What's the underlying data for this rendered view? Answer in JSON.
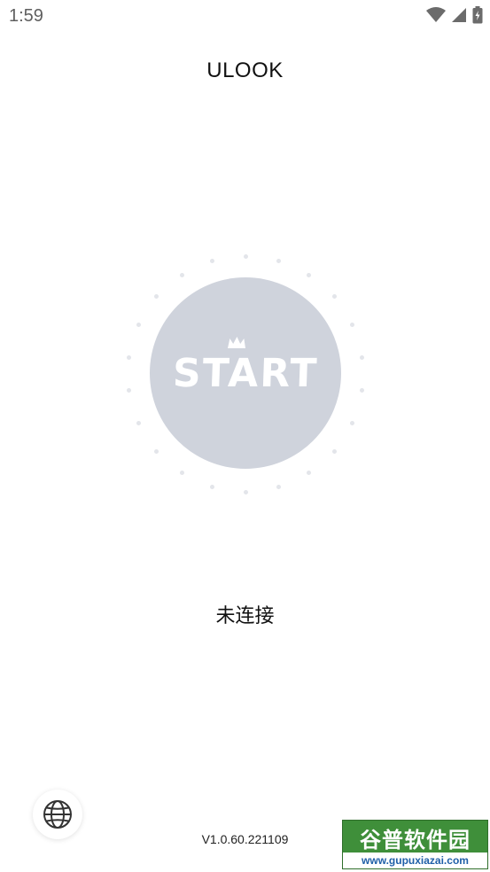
{
  "status_bar": {
    "time": "1:59",
    "icons": [
      "wifi-icon",
      "cellular-signal-icon",
      "battery-charging-icon"
    ]
  },
  "header": {
    "title": "ULOOK"
  },
  "main": {
    "start_button_label": "START",
    "connection_status": "未连接"
  },
  "footer": {
    "language_button_icon": "globe-icon",
    "version": "V1.0.60.221109"
  },
  "watermark": {
    "text": "谷普软件园",
    "url": "www.gupuxiazai.com"
  },
  "colors": {
    "start_button_fill": "#cfd3dc",
    "dot_color": "#e3e5ea",
    "watermark_green": "#3f8f3a"
  }
}
